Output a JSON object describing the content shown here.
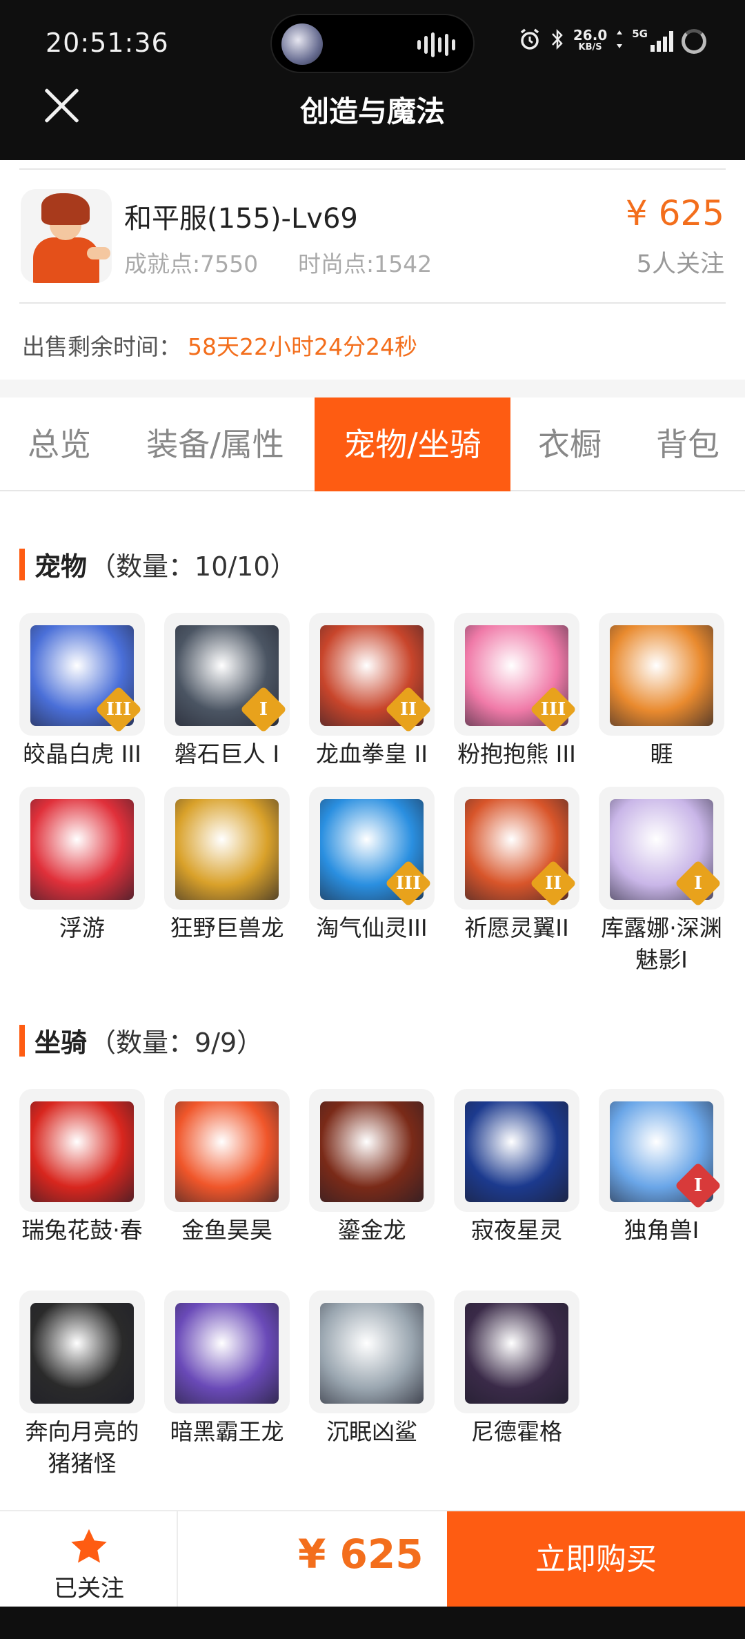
{
  "status_bar": {
    "time": "20:51:36",
    "net_speed": "26.0",
    "net_speed_unit": "KB/S",
    "network": "5G"
  },
  "header": {
    "title": "创造与魔法",
    "close_icon": "close-icon"
  },
  "account": {
    "name": "和平服(155)-Lv69",
    "achievement": "成就点:7550",
    "fashion": "时尚点:1542",
    "price": "¥ 625",
    "followers": "5人关注",
    "remain_label": "出售剩余时间：",
    "remain_value": "58天22小时24分24秒"
  },
  "tabs": [
    {
      "label": "总览",
      "active": false
    },
    {
      "label": "装备/属性",
      "active": false
    },
    {
      "label": "宠物/坐骑",
      "active": true
    },
    {
      "label": "衣橱",
      "active": false
    },
    {
      "label": "背包",
      "active": false
    }
  ],
  "pets": {
    "title": "宠物",
    "count": "（数量：10/10）",
    "items": [
      {
        "name": "皎晶白虎 III",
        "badge": "III",
        "badge_color": "#e8a21c",
        "color": "#4a6fd8"
      },
      {
        "name": "磐石巨人 I",
        "badge": "I",
        "badge_color": "#e8a21c",
        "color": "#4b5563"
      },
      {
        "name": "龙血拳皇 II",
        "badge": "II",
        "badge_color": "#e8a21c",
        "color": "#c8452b"
      },
      {
        "name": "粉抱抱熊 III",
        "badge": "III",
        "badge_color": "#e8a21c",
        "color": "#f07aa8"
      },
      {
        "name": "睚",
        "badge": "",
        "badge_color": "",
        "color": "#e98a2e"
      },
      {
        "name": "浮游",
        "badge": "",
        "badge_color": "",
        "color": "#e0303a"
      },
      {
        "name": "狂野巨兽龙",
        "badge": "",
        "badge_color": "",
        "color": "#d9a12a"
      },
      {
        "name": "淘气仙灵III",
        "badge": "III",
        "badge_color": "#e8a21c",
        "color": "#2a8fe0"
      },
      {
        "name": "祈愿灵翼II",
        "badge": "II",
        "badge_color": "#e8a21c",
        "color": "#d8552a"
      },
      {
        "name": "库露娜·深渊魅影I",
        "badge": "I",
        "badge_color": "#e8a21c",
        "color": "#c9b6e8"
      }
    ]
  },
  "mounts": {
    "title": "坐骑",
    "count": "（数量：9/9）",
    "items": [
      {
        "name": "瑞兔花鼓·春",
        "badge": "",
        "badge_color": "",
        "color": "#d8261e"
      },
      {
        "name": "金鱼昊昊",
        "badge": "",
        "badge_color": "",
        "color": "#f0562a"
      },
      {
        "name": "鎏金龙",
        "badge": "",
        "badge_color": "",
        "color": "#7a2a18"
      },
      {
        "name": "寂夜星灵",
        "badge": "",
        "badge_color": "",
        "color": "#1c3a8e"
      },
      {
        "name": "独角兽I",
        "badge": "I",
        "badge_color": "#d83a3a",
        "color": "#6aa6e8"
      },
      {
        "name": "奔向月亮的猪猪怪",
        "badge": "",
        "badge_color": "",
        "color": "#2a2a2a"
      },
      {
        "name": "暗黑霸王龙",
        "badge": "",
        "badge_color": "",
        "color": "#6a4ab8"
      },
      {
        "name": "沉眠凶鲨",
        "badge": "",
        "badge_color": "",
        "color": "#9aa6b0"
      },
      {
        "name": "尼德霍格",
        "badge": "",
        "badge_color": "",
        "color": "#3a2a48"
      }
    ]
  },
  "bottom": {
    "follow_label": "已关注",
    "star_icon": "star-icon",
    "price": "¥ 625",
    "buy_label": "立即购买"
  },
  "colors": {
    "accent": "#fe5c12",
    "price": "#f36e1c"
  }
}
